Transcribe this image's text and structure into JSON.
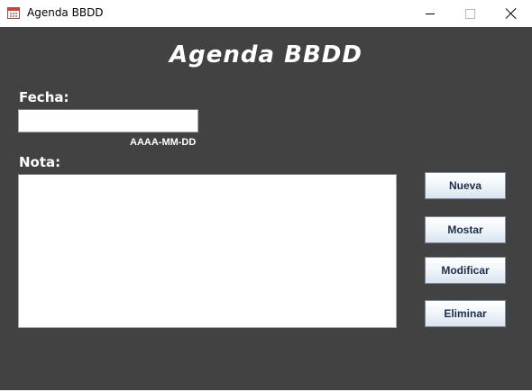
{
  "window": {
    "title": "Agenda BBDD",
    "icon": "calendar-icon",
    "controls": [
      "minimize-icon",
      "maximize-icon",
      "close-icon"
    ]
  },
  "colors": {
    "background": "#424242",
    "text": "#ffffff",
    "button_text": "#1c2f4a"
  },
  "header": {
    "title": "Agenda BBDD"
  },
  "form": {
    "fecha_label": "Fecha:",
    "fecha_value": "",
    "fecha_format_hint": "AAAA-MM-DD",
    "nota_label": "Nota:",
    "nota_value": ""
  },
  "actions": {
    "nueva": "Nueva",
    "mostar": "Mostar",
    "modificar": "Modificar",
    "eliminar": "Eliminar"
  }
}
